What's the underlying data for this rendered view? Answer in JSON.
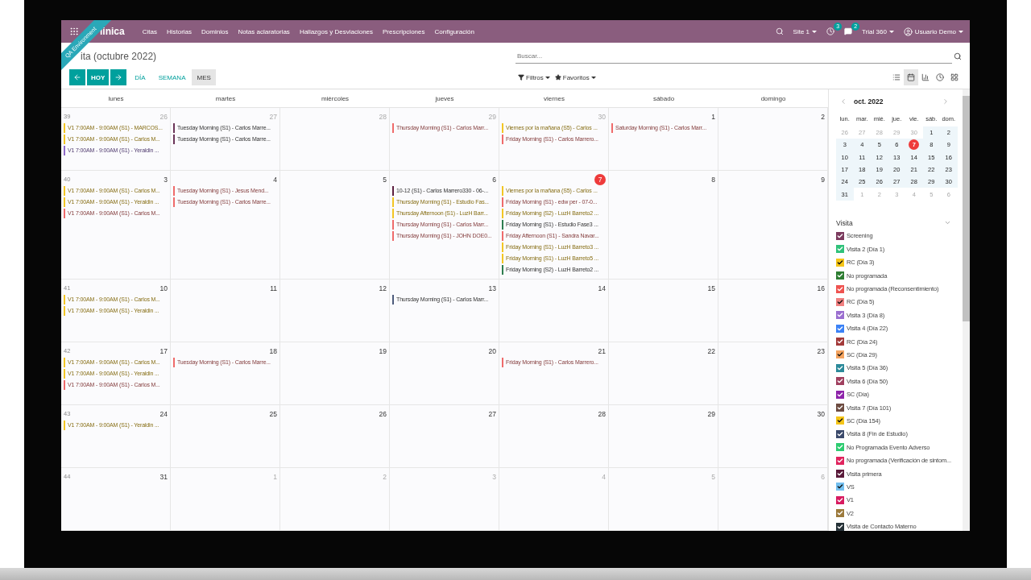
{
  "navbar": {
    "logo": "linica",
    "menu": [
      "Citas",
      "Historias",
      "Dominios",
      "Notas aclaratorias",
      "Hallazgos y Desviaciones",
      "Prescripciones",
      "Configuración"
    ],
    "site": "Site 1",
    "activity_count": "3",
    "message_count": "2",
    "company": "Trial 360",
    "user": "Usuario Demo"
  },
  "ribbon": "QA Environment",
  "control_panel": {
    "title": "ita (octubre 2022)",
    "search": {
      "placeholder": "Buscar..."
    },
    "today_button": "HOY",
    "scales": [
      {
        "label": "DÍA",
        "selected": false
      },
      {
        "label": "SEMANA",
        "selected": false
      },
      {
        "label": "MES",
        "selected": true
      }
    ],
    "filters": "Filtros",
    "favorites": "Favoritos",
    "views": [
      {
        "kind": "list",
        "selected": false
      },
      {
        "kind": "calendar",
        "selected": true
      },
      {
        "kind": "graph",
        "selected": false
      },
      {
        "kind": "activity",
        "selected": false
      },
      {
        "kind": "pivot",
        "selected": false
      }
    ]
  },
  "calendar": {
    "weekdays": [
      "lunes",
      "martes",
      "miércoles",
      "jueves",
      "viernes",
      "sábado",
      "domingo"
    ],
    "weeks": [
      {
        "number": "39",
        "days": [
          {
            "day": "26",
            "muted": true,
            "today": false,
            "events": [
              {
                "label": "V1 7:00AM - 9:00AM (S1) - MARCOS...",
                "color": "#f3c623"
              },
              {
                "label": "V1 7:00AM - 9:00AM (S1) - Carlos M...",
                "color": "#f3c623"
              },
              {
                "label": "V1 7:00AM - 9:00AM (S1) - Yeraldin ...",
                "color": "#8f6ac8"
              }
            ]
          },
          {
            "day": "27",
            "muted": true,
            "today": false,
            "events": [
              {
                "label": "Tuesday Morning (S1) - Carlos Marre...",
                "color": "#6b3558"
              },
              {
                "label": "Tuesday Morning (S1) - Carlos Marre...",
                "color": "#6b3558"
              }
            ]
          },
          {
            "day": "28",
            "muted": true,
            "today": false
          },
          {
            "day": "29",
            "muted": true,
            "today": false,
            "events": [
              {
                "label": "Thursday Morning (S1) - Carlos Marr...",
                "color": "#ef6b6b"
              }
            ]
          },
          {
            "day": "30",
            "muted": true,
            "today": false,
            "events": [
              {
                "label": "Viernes por la mañana (S5) - Carlos ...",
                "color": "#f3c623"
              },
              {
                "label": "Friday Morning (S1) - Carlos Marrero...",
                "color": "#ef6b6b"
              }
            ]
          },
          {
            "day": "1",
            "muted": false,
            "today": false,
            "events": [
              {
                "label": "Saturday Morning (S1) - Carlos Marr...",
                "color": "#ef6b6b"
              }
            ]
          },
          {
            "day": "2",
            "muted": false,
            "today": false
          }
        ]
      },
      {
        "number": "40",
        "days": [
          {
            "day": "3",
            "muted": false,
            "today": false,
            "events": [
              {
                "label": "V1 7:00AM - 9:00AM (S1) - Carlos M...",
                "color": "#f3c623"
              },
              {
                "label": "V1 7:00AM - 9:00AM (S1) - Yeraldin ...",
                "color": "#f3c623"
              },
              {
                "label": "V1 7:00AM - 9:00AM (S1) - Carlos M...",
                "color": "#ef6b6b"
              }
            ]
          },
          {
            "day": "4",
            "muted": false,
            "today": false,
            "events": [
              {
                "label": "Tuesday Morning (S1) - Jesus Mend...",
                "color": "#ef6b6b"
              },
              {
                "label": "Tuesday Morning (S1) - Carlos Marre...",
                "color": "#ef6b6b"
              }
            ]
          },
          {
            "day": "5",
            "muted": false,
            "today": false
          },
          {
            "day": "6",
            "muted": false,
            "today": false,
            "events": [
              {
                "label": "10-12 (S1) - Carlos Marrero330 - 06-...",
                "color": "#5e2040"
              },
              {
                "label": "Thursday Morning (S1) - Estudio Fas...",
                "color": "#f3c623"
              },
              {
                "label": "Thursday Afternoon (S1) - LuzH Barr...",
                "color": "#f3c623"
              },
              {
                "label": "Thursday Morning (S1) - Carlos Marr...",
                "color": "#ef6b6b"
              },
              {
                "label": "Thursday Morning (S1) - JOHN DOE0...",
                "color": "#ef6b6b"
              }
            ]
          },
          {
            "day": "7",
            "muted": false,
            "today": true,
            "events": [
              {
                "label": "Viernes por la mañana (S5) - Carlos ...",
                "color": "#f3c623"
              },
              {
                "label": "Friday Morning (S1) - edw per - 07-0...",
                "color": "#ef6b6b"
              },
              {
                "label": "Friday Morning (S2) - LuzH Barreto2 ...",
                "color": "#f3c623"
              },
              {
                "label": "Friday Morning (S1) - Estudio Fase3 ...",
                "color": "#2e7d4f"
              },
              {
                "label": "Friday Afternoon (S1) - Sandra Navar...",
                "color": "#ef6b6b"
              },
              {
                "label": "Friday Morning (S1) - LuzH Barreto3 ...",
                "color": "#f3c623"
              },
              {
                "label": "Friday Morning (S1) - LuzH Barreto5 ...",
                "color": "#f3c623"
              },
              {
                "label": "Friday Morning (S2) - LuzH Barreto2 ...",
                "color": "#2e7d4f"
              }
            ]
          },
          {
            "day": "8",
            "muted": false,
            "today": false
          },
          {
            "day": "9",
            "muted": false,
            "today": false
          }
        ]
      },
      {
        "number": "41",
        "days": [
          {
            "day": "10",
            "muted": false,
            "today": false,
            "events": [
              {
                "label": "V1 7:00AM - 9:00AM (S1) - Carlos M...",
                "color": "#f3c623"
              },
              {
                "label": "V1 7:00AM - 9:00AM (S1) - Yeraldin ...",
                "color": "#f3c623"
              }
            ]
          },
          {
            "day": "11",
            "muted": false,
            "today": false
          },
          {
            "day": "12",
            "muted": false,
            "today": false
          },
          {
            "day": "13",
            "muted": false,
            "today": false,
            "events": [
              {
                "label": "Thursday Morning (S1) - Carlos Marr...",
                "color": "#4d5b7c"
              }
            ]
          },
          {
            "day": "14",
            "muted": false,
            "today": false
          },
          {
            "day": "15",
            "muted": false,
            "today": false
          },
          {
            "day": "16",
            "muted": false,
            "today": false
          }
        ]
      },
      {
        "number": "42",
        "days": [
          {
            "day": "17",
            "muted": false,
            "today": false,
            "events": [
              {
                "label": "V1 7:00AM - 9:00AM (S1) - Carlos M...",
                "color": "#f3c623"
              },
              {
                "label": "V1 7:00AM - 9:00AM (S1) - Yeraldin ...",
                "color": "#f3c623"
              },
              {
                "label": "V1 7:00AM - 9:00AM (S1) - Carlos M...",
                "color": "#ef6b6b"
              }
            ]
          },
          {
            "day": "18",
            "muted": false,
            "today": false,
            "events": [
              {
                "label": "Tuesday Morning (S1) - Carlos Marre...",
                "color": "#ef6b6b"
              }
            ]
          },
          {
            "day": "19",
            "muted": false,
            "today": false
          },
          {
            "day": "20",
            "muted": false,
            "today": false
          },
          {
            "day": "21",
            "muted": false,
            "today": false,
            "events": [
              {
                "label": "Friday Morning (S1) - Carlos Marrero...",
                "color": "#ef6b6b"
              }
            ]
          },
          {
            "day": "22",
            "muted": false,
            "today": false
          },
          {
            "day": "23",
            "muted": false,
            "today": false
          }
        ]
      },
      {
        "number": "43",
        "days": [
          {
            "day": "24",
            "muted": false,
            "today": false,
            "events": [
              {
                "label": "V1 7:00AM - 9:00AM (S1) - Yeraldin ...",
                "color": "#f3c623"
              }
            ]
          },
          {
            "day": "25",
            "muted": false,
            "today": false
          },
          {
            "day": "26",
            "muted": false,
            "today": false
          },
          {
            "day": "27",
            "muted": false,
            "today": false
          },
          {
            "day": "28",
            "muted": false,
            "today": false
          },
          {
            "day": "29",
            "muted": false,
            "today": false
          },
          {
            "day": "30",
            "muted": false,
            "today": false
          }
        ]
      },
      {
        "number": "44",
        "days": [
          {
            "day": "31",
            "muted": false,
            "today": false
          },
          {
            "day": "1",
            "muted": true,
            "today": false
          },
          {
            "day": "2",
            "muted": true,
            "today": false
          },
          {
            "day": "3",
            "muted": true,
            "today": false
          },
          {
            "day": "4",
            "muted": true,
            "today": false
          },
          {
            "day": "5",
            "muted": true,
            "today": false
          },
          {
            "day": "6",
            "muted": true,
            "today": false
          }
        ]
      }
    ]
  },
  "sidebar": {
    "mini_calendar": {
      "title": "oct. 2022",
      "weekdays": [
        "lun.",
        "mar.",
        "mié.",
        "jue.",
        "vie.",
        "sáb.",
        "dom."
      ],
      "weeks": [
        [
          {
            "day": "26",
            "muted": true,
            "today": false
          },
          {
            "day": "27",
            "muted": true,
            "today": false
          },
          {
            "day": "28",
            "muted": true,
            "today": false
          },
          {
            "day": "29",
            "muted": true,
            "today": false
          },
          {
            "day": "30",
            "muted": true,
            "today": false
          },
          {
            "day": "1",
            "muted": false,
            "today": false
          },
          {
            "day": "2",
            "muted": false,
            "today": false
          }
        ],
        [
          {
            "day": "3",
            "muted": false,
            "today": false
          },
          {
            "day": "4",
            "muted": false,
            "today": false
          },
          {
            "day": "5",
            "muted": false,
            "today": false
          },
          {
            "day": "6",
            "muted": false,
            "today": false
          },
          {
            "day": "7",
            "muted": false,
            "today": true
          },
          {
            "day": "8",
            "muted": false,
            "today": false
          },
          {
            "day": "9",
            "muted": false,
            "today": false
          }
        ],
        [
          {
            "day": "10",
            "muted": false,
            "today": false
          },
          {
            "day": "11",
            "muted": false,
            "today": false
          },
          {
            "day": "12",
            "muted": false,
            "today": false
          },
          {
            "day": "13",
            "muted": false,
            "today": false
          },
          {
            "day": "14",
            "muted": false,
            "today": false
          },
          {
            "day": "15",
            "muted": false,
            "today": false
          },
          {
            "day": "16",
            "muted": false,
            "today": false
          }
        ],
        [
          {
            "day": "17",
            "muted": false,
            "today": false
          },
          {
            "day": "18",
            "muted": false,
            "today": false
          },
          {
            "day": "19",
            "muted": false,
            "today": false
          },
          {
            "day": "20",
            "muted": false,
            "today": false
          },
          {
            "day": "21",
            "muted": false,
            "today": false
          },
          {
            "day": "22",
            "muted": false,
            "today": false
          },
          {
            "day": "23",
            "muted": false,
            "today": false
          }
        ],
        [
          {
            "day": "24",
            "muted": false,
            "today": false
          },
          {
            "day": "25",
            "muted": false,
            "today": false
          },
          {
            "day": "26",
            "muted": false,
            "today": false
          },
          {
            "day": "27",
            "muted": false,
            "today": false
          },
          {
            "day": "28",
            "muted": false,
            "today": false
          },
          {
            "day": "29",
            "muted": false,
            "today": false
          },
          {
            "day": "30",
            "muted": false,
            "today": false
          }
        ],
        [
          {
            "day": "31",
            "muted": false,
            "today": false
          },
          {
            "day": "1",
            "muted": true,
            "today": false
          },
          {
            "day": "2",
            "muted": true,
            "today": false
          },
          {
            "day": "3",
            "muted": true,
            "today": false
          },
          {
            "day": "4",
            "muted": true,
            "today": false
          },
          {
            "day": "5",
            "muted": true,
            "today": false
          },
          {
            "day": "6",
            "muted": true,
            "today": false
          }
        ]
      ]
    },
    "filter": {
      "title": "Visita",
      "items": [
        {
          "label": "Screening",
          "color": "#7b3b5e",
          "checked": true
        },
        {
          "label": "Visita 2 (Día 1)",
          "color": "#30c27a",
          "checked": true
        },
        {
          "label": "RC (Día 3)",
          "color": "#f5c518",
          "checked": true
        },
        {
          "label": "No programada",
          "color": "#2e7d32",
          "checked": true
        },
        {
          "label": "No programada (Reconsentimiento)",
          "color": "#ef5350",
          "checked": true
        },
        {
          "label": "RC (Día 5)",
          "color": "#f08080",
          "checked": true
        },
        {
          "label": "Visita 3 (Día 8)",
          "color": "#9b6fd0",
          "checked": true
        },
        {
          "label": "Visita 4 (Día 22)",
          "color": "#3b82f6",
          "checked": true
        },
        {
          "label": "RC (Día 24)",
          "color": "#a33a3a",
          "checked": true
        },
        {
          "label": "SC (Día 29)",
          "color": "#f4a460",
          "checked": true
        },
        {
          "label": "Visita 5 (Día 36)",
          "color": "#2b8a9a",
          "checked": true
        },
        {
          "label": "Visita 6 (Día 50)",
          "color": "#a0405f",
          "checked": true
        },
        {
          "label": "SC (Día)",
          "color": "#8e24aa",
          "checked": true
        },
        {
          "label": "Visita 7 (Día 101)",
          "color": "#6d4c41",
          "checked": true
        },
        {
          "label": "SC (Día 154)",
          "color": "#f5c518",
          "checked": true
        },
        {
          "label": "Visita 8 (Fin de Estudio)",
          "color": "#3b4a6b",
          "checked": true
        },
        {
          "label": "No Programada Evento Adverso",
          "color": "#2ecc71",
          "checked": true
        },
        {
          "label": "No programada (Verificación de sintom...",
          "color": "#e0245e",
          "checked": true
        },
        {
          "label": "Visita primera",
          "color": "#5a1a3a",
          "checked": true
        },
        {
          "label": "VS",
          "color": "#74c0f0",
          "checked": true
        },
        {
          "label": "V1",
          "color": "#d81b60",
          "checked": true
        },
        {
          "label": "V2",
          "color": "#9c7a3c",
          "checked": true
        },
        {
          "label": "Visita de Contacto Materno",
          "color": "#263238",
          "checked": true
        }
      ]
    }
  }
}
